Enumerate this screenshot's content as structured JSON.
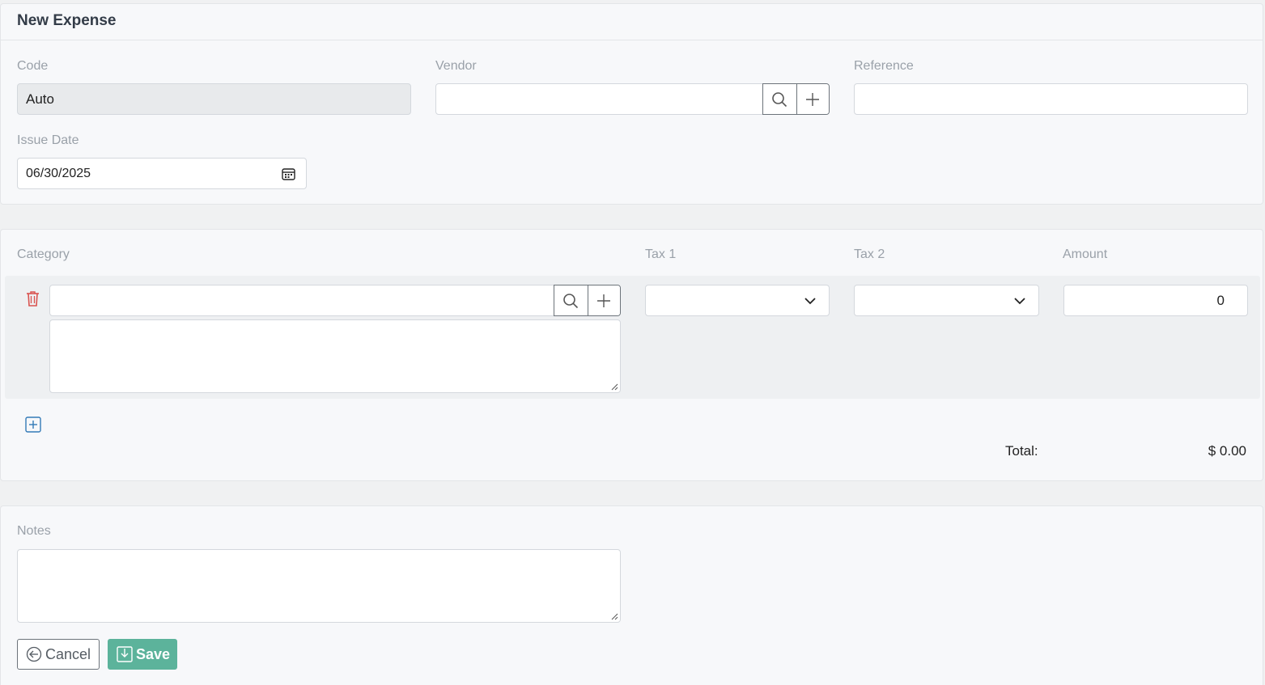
{
  "header": {
    "title": "New Expense"
  },
  "fields": {
    "code": {
      "label": "Code",
      "value": "Auto"
    },
    "vendor": {
      "label": "Vendor",
      "value": ""
    },
    "reference": {
      "label": "Reference",
      "value": ""
    },
    "issue_date": {
      "label": "Issue Date",
      "value": "06/30/2025"
    }
  },
  "items": {
    "columns": {
      "category": "Category",
      "tax1": "Tax 1",
      "tax2": "Tax 2",
      "amount": "Amount"
    },
    "rows": [
      {
        "category": "",
        "description": "",
        "tax1": "",
        "tax2": "",
        "amount": "0"
      }
    ],
    "total_label": "Total:",
    "total_value": "$ 0.00"
  },
  "notes": {
    "label": "Notes",
    "value": ""
  },
  "actions": {
    "cancel_label": "Cancel",
    "save_label": "Save"
  },
  "colors": {
    "accent": "#5cb39b",
    "danger": "#d9534f",
    "primary": "#337ab7"
  },
  "icons": {
    "search": "search-icon",
    "add": "plus-icon",
    "calendar": "calendar-icon",
    "delete": "trash-icon",
    "add_row": "plus-square-icon",
    "cancel": "arrow-left-circle-icon",
    "save": "save-icon",
    "dropdown": "chevron-down-icon"
  }
}
